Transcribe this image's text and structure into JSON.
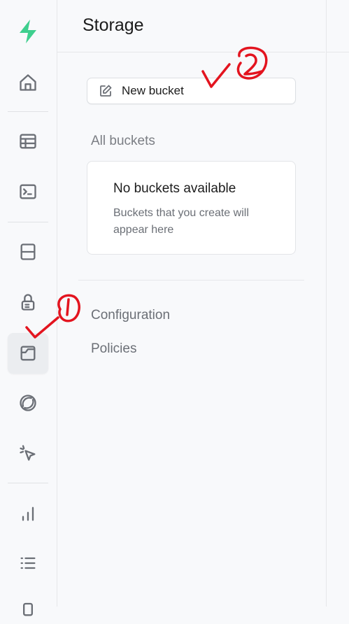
{
  "sidebar": {
    "icons": [
      {
        "name": "supabase-logo-icon"
      },
      {
        "name": "home-icon"
      },
      {
        "name": "table-editor-icon"
      },
      {
        "name": "sql-editor-icon"
      },
      {
        "name": "database-icon"
      },
      {
        "name": "authentication-icon"
      },
      {
        "name": "storage-icon",
        "active": true
      },
      {
        "name": "edge-functions-icon"
      },
      {
        "name": "realtime-icon"
      },
      {
        "name": "reports-icon"
      },
      {
        "name": "logs-icon"
      }
    ],
    "brand_color": "#3ecf8e"
  },
  "header": {
    "title": "Storage"
  },
  "new_bucket_button": {
    "label": "New bucket"
  },
  "all_buckets": {
    "label": "All buckets",
    "empty_title": "No buckets available",
    "empty_description": "Buckets that you create will appear here"
  },
  "menu": {
    "configuration_label": "Configuration",
    "policies_label": "Policies"
  },
  "annotations": {
    "mark_1": "1",
    "mark_2": "2",
    "color": "#e3141f"
  }
}
